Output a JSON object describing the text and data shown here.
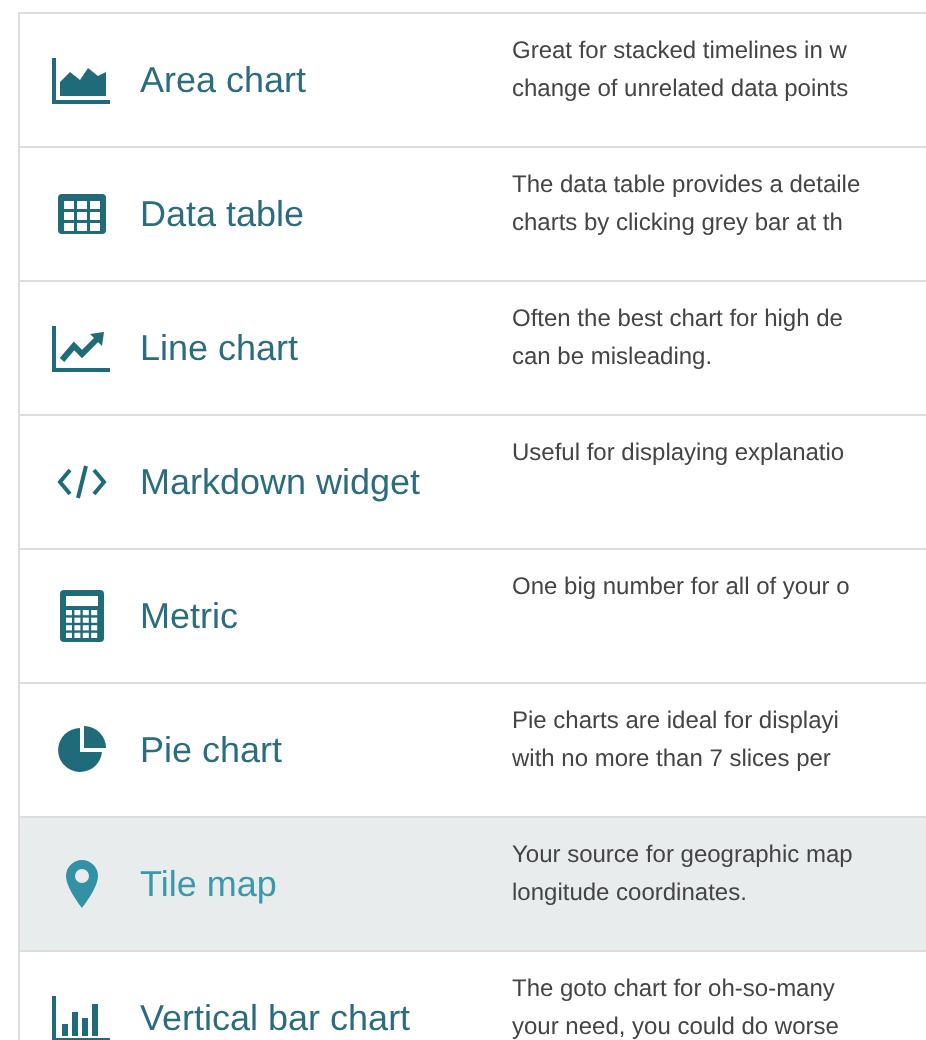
{
  "widgets": [
    {
      "kind": "area",
      "label": "Area chart",
      "selected": false,
      "description": [
        "Great for stacked timelines in w",
        "change of unrelated data points"
      ]
    },
    {
      "kind": "table",
      "label": "Data table",
      "selected": false,
      "description": [
        "The data table provides a detaile",
        "charts by clicking grey bar at th"
      ]
    },
    {
      "kind": "line",
      "label": "Line chart",
      "selected": false,
      "description": [
        "Often the best chart for high de",
        "can be misleading."
      ]
    },
    {
      "kind": "code",
      "label": "Markdown widget",
      "selected": false,
      "description": [
        "Useful for displaying explanatio"
      ]
    },
    {
      "kind": "calculator",
      "label": "Metric",
      "selected": false,
      "description": [
        "One big number for all of your o"
      ]
    },
    {
      "kind": "pie",
      "label": "Pie chart",
      "selected": false,
      "description": [
        "Pie charts are ideal for displayi",
        "with no more than 7 slices per "
      ]
    },
    {
      "kind": "pin",
      "label": "Tile map",
      "selected": true,
      "description": [
        "Your source for geographic map",
        "longitude coordinates."
      ]
    },
    {
      "kind": "bars",
      "label": "Vertical bar chart",
      "selected": false,
      "description": [
        "The goto chart for oh-so-many ",
        "your need, you could do worse"
      ]
    }
  ]
}
